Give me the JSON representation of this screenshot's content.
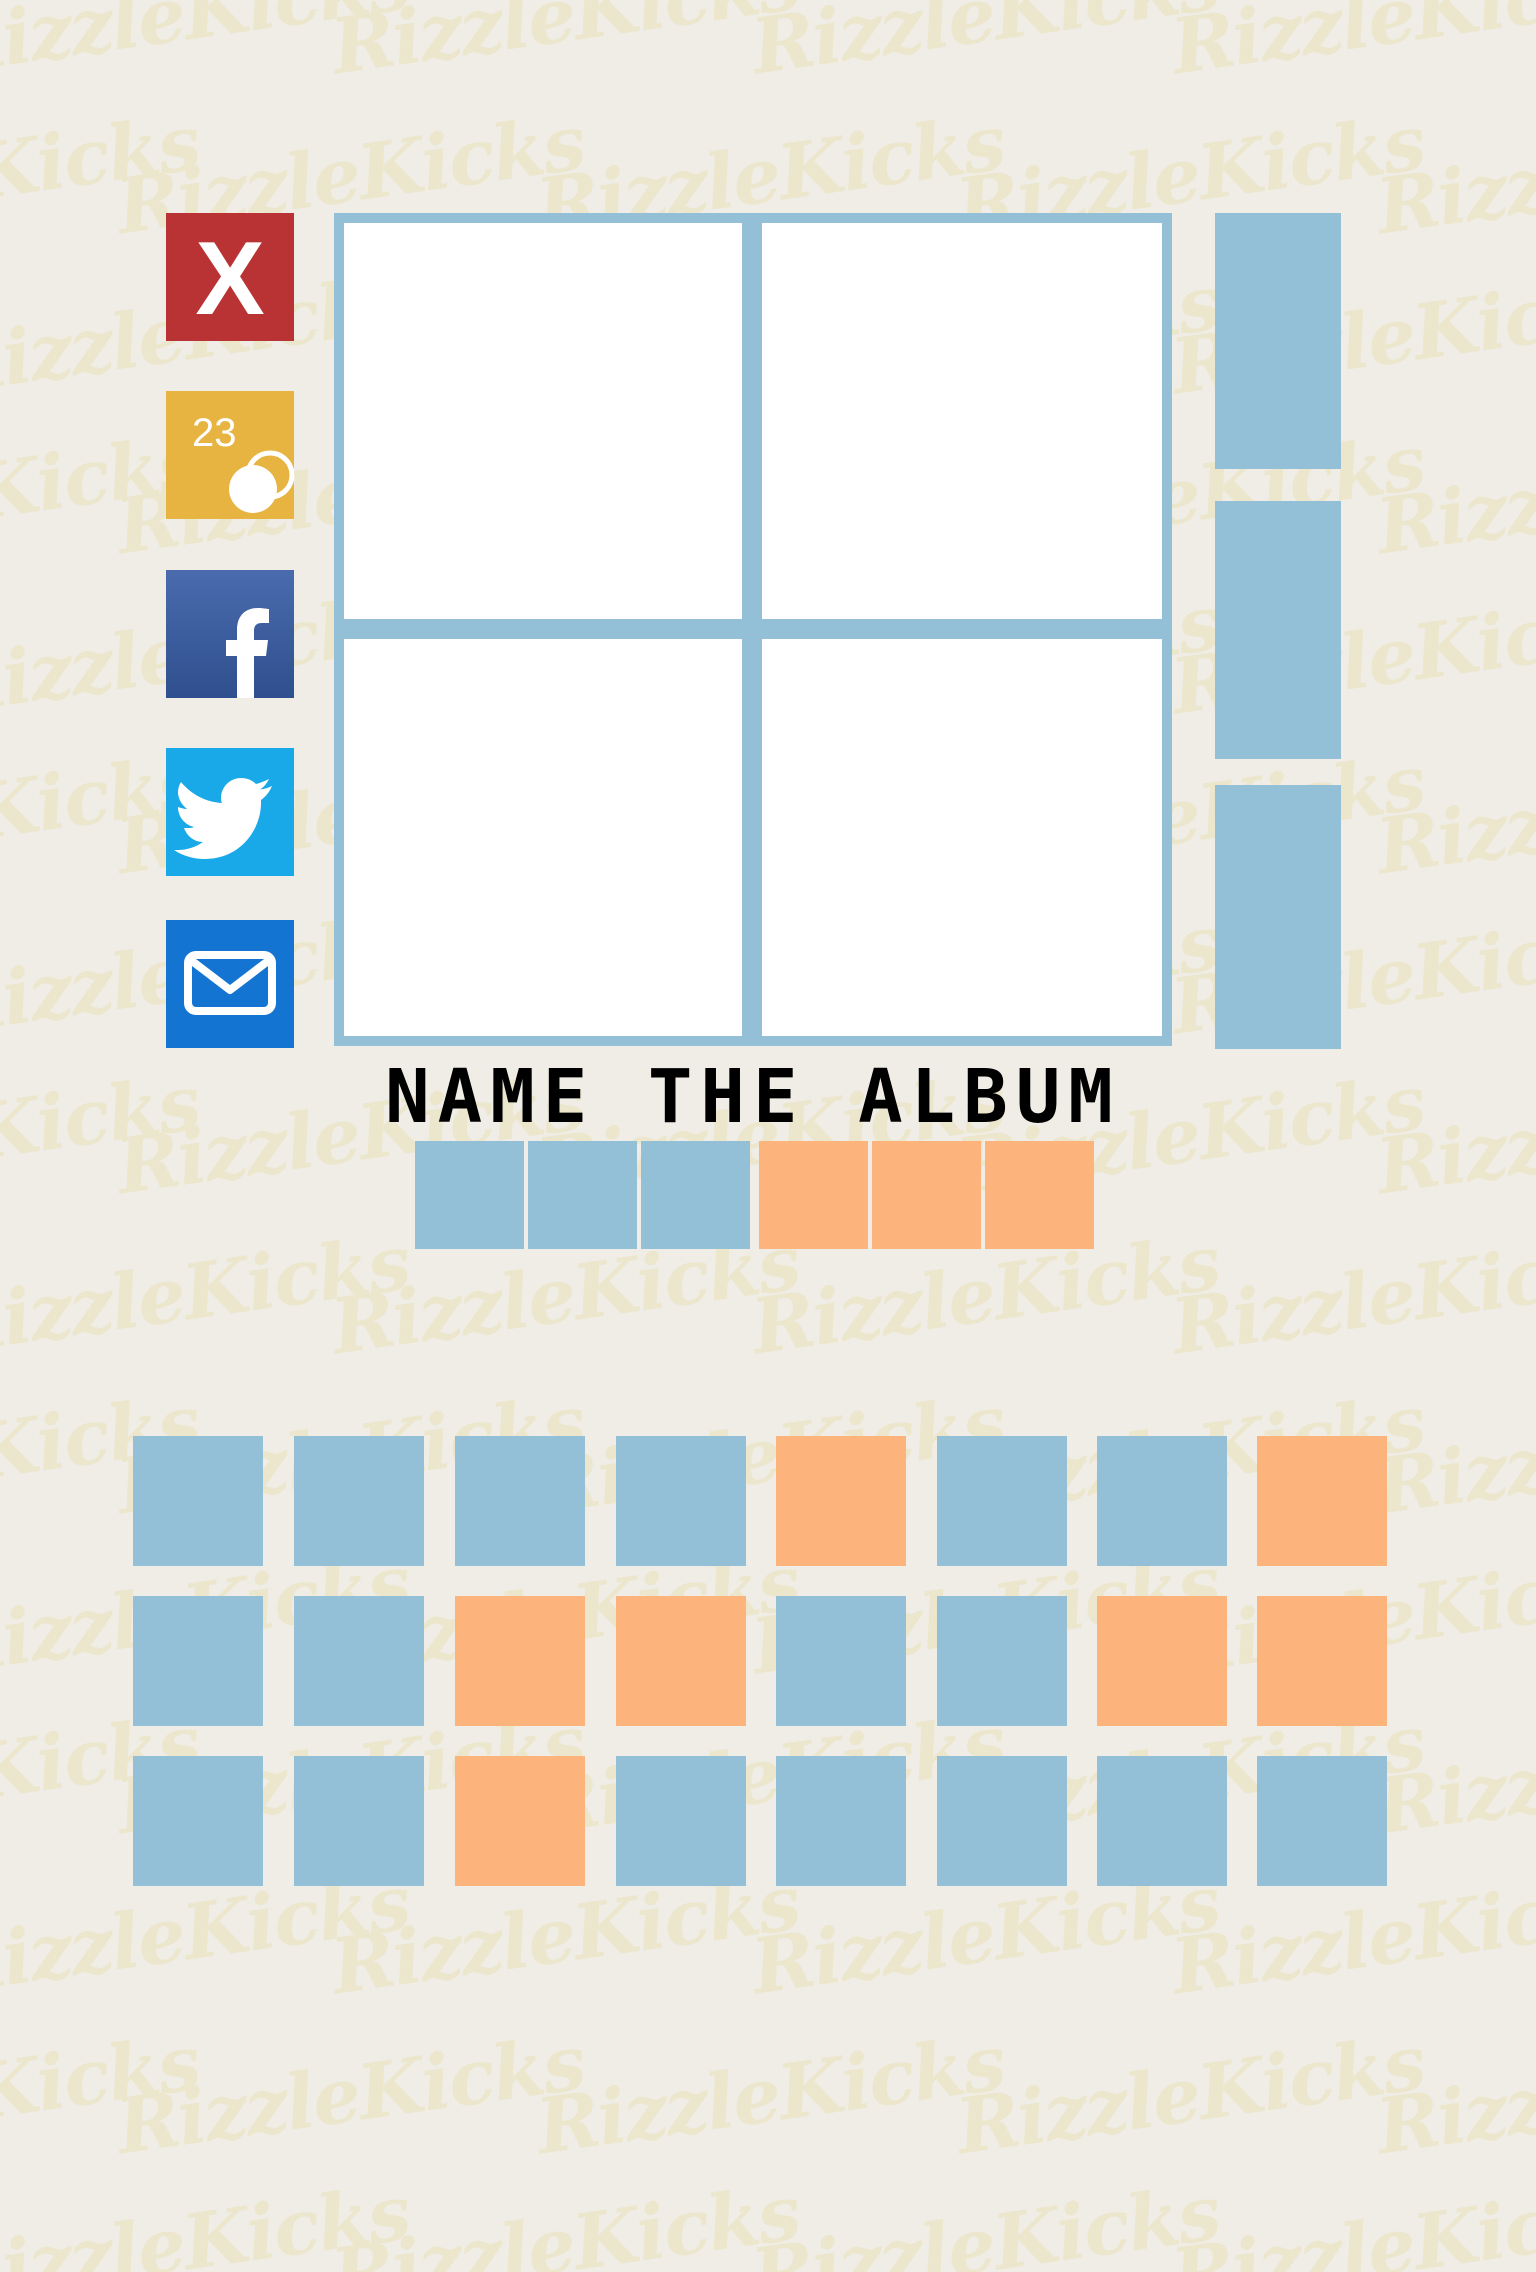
{
  "colors": {
    "background": "#efede6",
    "watermark": "#ebe6cc",
    "frame_blue": "#93bfd7",
    "slot_blue": "#93bfd7",
    "slot_orange": "#fcb47c",
    "close_red": "#b93334",
    "coins_gold": "#e7b341",
    "facebook_blue": "#3a5a9a",
    "twitter_blue": "#1aa9e8",
    "mail_blue": "#1474d2"
  },
  "watermark_text": "RizzleKicks",
  "social": [
    {
      "icon": "close-icon",
      "label": "X"
    },
    {
      "icon": "coins-icon",
      "label": "23"
    },
    {
      "icon": "facebook-icon"
    },
    {
      "icon": "twitter-icon"
    },
    {
      "icon": "mail-icon"
    }
  ],
  "coins": {
    "count": "23"
  },
  "close_label": "X",
  "puzzle": {
    "title": "NAME THE ALBUM",
    "answer_slots": [
      "blue",
      "blue",
      "blue",
      "orange",
      "orange",
      "orange"
    ]
  },
  "letter_tiles": [
    [
      "blue",
      "blue",
      "blue",
      "blue",
      "orange",
      "blue",
      "blue",
      "orange"
    ],
    [
      "blue",
      "blue",
      "orange",
      "orange",
      "blue",
      "blue",
      "orange",
      "orange"
    ],
    [
      "blue",
      "blue",
      "orange",
      "blue",
      "blue",
      "blue",
      "blue",
      "blue"
    ]
  ]
}
